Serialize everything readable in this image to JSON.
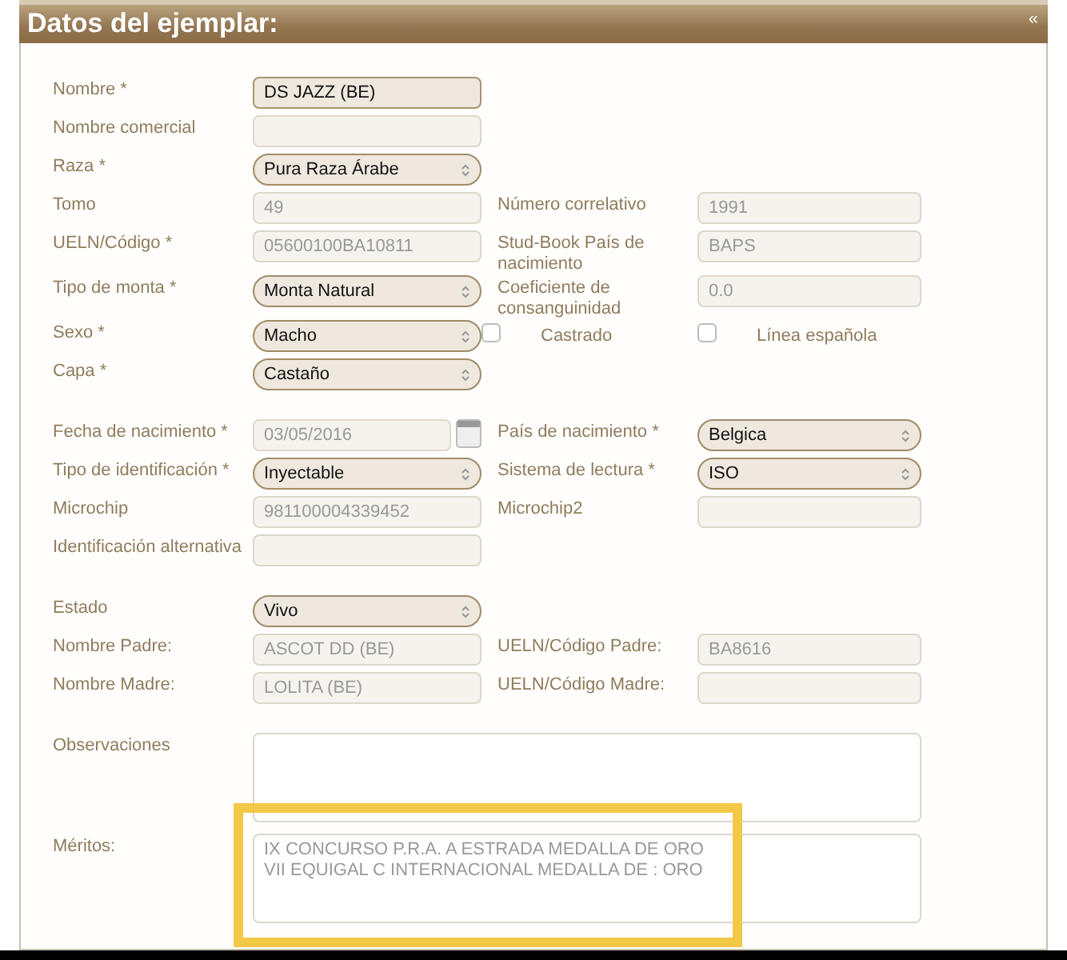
{
  "panel": {
    "title": "Datos del ejemplar:",
    "collapse": "«"
  },
  "sections": [
    {
      "rows": [
        {
          "cells": [
            {
              "kind": "field",
              "label": "Nombre *",
              "field": {
                "kind": "input",
                "value": "DS JAZZ (BE)",
                "readonly": false
              }
            }
          ]
        },
        {
          "cells": [
            {
              "kind": "field",
              "label": "Nombre comercial",
              "field": {
                "kind": "input",
                "readonly": true
              }
            }
          ]
        },
        {
          "cells": [
            {
              "kind": "field",
              "label": "Raza *",
              "field": {
                "kind": "select",
                "value": "Pura Raza Árabe"
              }
            }
          ]
        },
        {
          "cells": [
            {
              "kind": "field",
              "label": "Tomo",
              "field": {
                "kind": "input",
                "value": "49",
                "readonly": true
              }
            },
            {
              "kind": "field",
              "label": "Número correlativo",
              "field": {
                "kind": "input",
                "value": "1991",
                "readonly": true
              }
            }
          ]
        },
        {
          "cells": [
            {
              "kind": "field",
              "label": "UELN/Código *",
              "field": {
                "kind": "input",
                "value": "05600100BA10811",
                "readonly": true
              }
            },
            {
              "kind": "field",
              "label": "Stud-Book País de nacimiento",
              "field": {
                "kind": "input",
                "value": "BAPS",
                "readonly": true
              }
            }
          ]
        },
        {
          "cells": [
            {
              "kind": "field",
              "label": "Tipo de monta *",
              "field": {
                "kind": "select",
                "value": "Monta Natural"
              }
            },
            {
              "kind": "field",
              "label": "Coeficiente de consanguinidad",
              "field": {
                "kind": "input",
                "value": "0.0",
                "readonly": true
              }
            }
          ]
        },
        {
          "cells": [
            {
              "kind": "field",
              "label": "Sexo *",
              "field": {
                "kind": "select",
                "value": "Macho"
              }
            },
            {
              "kind": "check",
              "label": "Castrado",
              "checked": false
            },
            {
              "kind": "check",
              "label": "Línea española",
              "checked": false
            }
          ]
        },
        {
          "cells": [
            {
              "kind": "field",
              "label": "Capa *",
              "field": {
                "kind": "select",
                "value": "Castaño"
              }
            }
          ]
        }
      ]
    },
    {
      "rows": [
        {
          "cells": [
            {
              "kind": "field",
              "label": "Fecha de nacimiento *",
              "field": {
                "kind": "date",
                "value": "03/05/2016",
                "readonly": true
              }
            },
            {
              "kind": "field",
              "label": "País de nacimiento *",
              "field": {
                "kind": "select",
                "value": "Belgica"
              }
            }
          ]
        },
        {
          "cells": [
            {
              "kind": "field",
              "label": "Tipo de identificación *",
              "field": {
                "kind": "select",
                "value": "Inyectable"
              }
            },
            {
              "kind": "field",
              "label": "Sistema de lectura *",
              "field": {
                "kind": "select",
                "value": "ISO"
              }
            }
          ]
        },
        {
          "cells": [
            {
              "kind": "field",
              "label": "Microchip",
              "field": {
                "kind": "input",
                "value": "981100004339452",
                "readonly": true
              }
            },
            {
              "kind": "field",
              "label": "Microchip2",
              "field": {
                "kind": "input",
                "readonly": true
              }
            }
          ]
        },
        {
          "cells": [
            {
              "kind": "field",
              "label": "Identificación alternativa",
              "field": {
                "kind": "input",
                "readonly": true
              }
            }
          ]
        }
      ]
    },
    {
      "rows": [
        {
          "cells": [
            {
              "kind": "field",
              "label": "Estado",
              "field": {
                "kind": "select",
                "value": "Vivo"
              }
            }
          ]
        },
        {
          "cells": [
            {
              "kind": "field",
              "label": "Nombre Padre:",
              "field": {
                "kind": "input",
                "value": "ASCOT DD (BE)",
                "readonly": true
              }
            },
            {
              "kind": "field",
              "label": "UELN/Código Padre:",
              "field": {
                "kind": "input",
                "value": "BA8616",
                "readonly": true
              }
            }
          ]
        },
        {
          "cells": [
            {
              "kind": "field",
              "label": "Nombre Madre:",
              "field": {
                "kind": "input",
                "value": "LOLITA (BE)",
                "readonly": true
              }
            },
            {
              "kind": "field",
              "label": "UELN/Código Madre:",
              "field": {
                "kind": "input",
                "readonly": true
              }
            }
          ]
        }
      ]
    },
    {
      "rows": [
        {
          "cells": [
            {
              "kind": "field",
              "label": "Observaciones",
              "field": {
                "kind": "textarea"
              }
            }
          ]
        },
        {
          "cells": [
            {
              "kind": "field",
              "label": "Méritos:",
              "highlighted": true,
              "field": {
                "kind": "textarea",
                "value": "IX CONCURSO P.R.A. A ESTRADA MEDALLA DE ORO\nVII EQUIGAL C INTERNACIONAL MEDALLA DE : ORO",
                "readonly": true
              }
            }
          ]
        }
      ]
    }
  ]
}
